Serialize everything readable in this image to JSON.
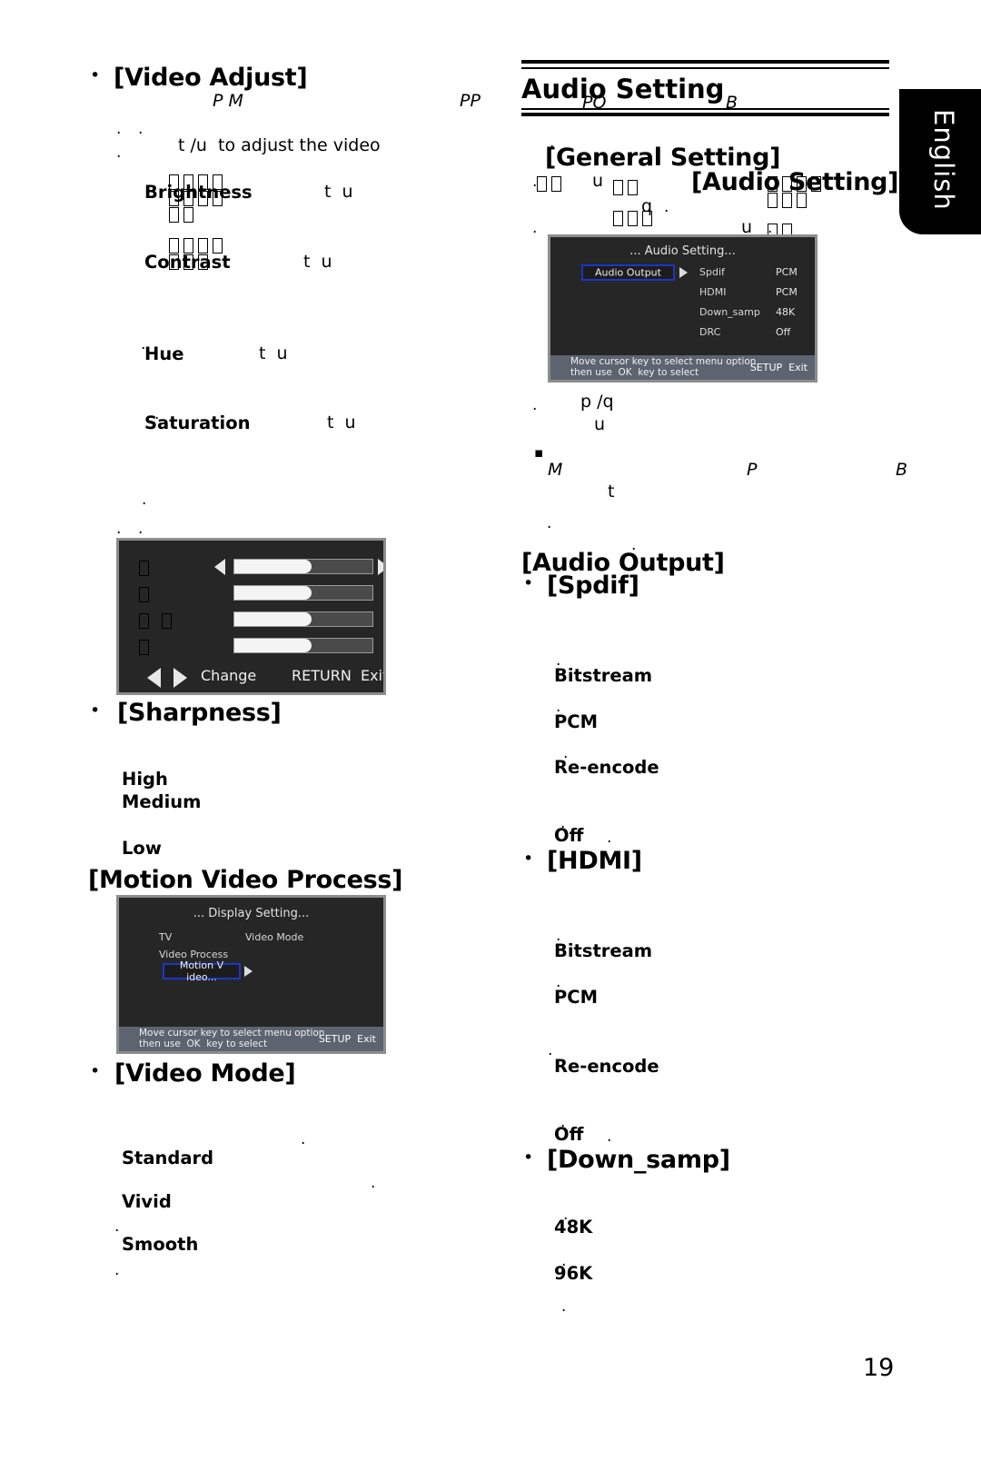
{
  "page": {
    "number": "19",
    "language_tab": "English"
  },
  "left_column": {
    "video_adjust_heading": "[Video Adjust]",
    "frag_pm": "P M",
    "frag_pp": "PP",
    "frag_dot_a": ".",
    "frag_dot_b": ".",
    "frag_dot_c": ".",
    "instruction": "t /u  to adjust the video",
    "items": [
      {
        "label": "Brightness",
        "keys": "t  u"
      },
      {
        "label": "Contrast",
        "keys": "t  u"
      },
      {
        "label": "Hue",
        "keys": "t  u"
      },
      {
        "label": "Saturation",
        "keys": "t  u"
      }
    ],
    "sharpness_heading": "[Sharpness]",
    "sharpness_options": [
      "High",
      "Medium",
      "Low"
    ],
    "motion_video_heading": "[Motion Video Process]",
    "video_mode_heading": "[Video Mode]",
    "video_mode_options": [
      "Standard",
      "Vivid",
      "Smooth"
    ]
  },
  "right_column": {
    "heading": "Audio Setting",
    "heading_frag_po": "PO",
    "heading_frag_b": "B",
    "general_setting": "[General Setting]",
    "audio_setting": "[Audio Setting]",
    "frag_u1": "u",
    "frag_q": "q",
    "frag_u2": "u",
    "frag_pq": "p /q",
    "frag_u3": "u",
    "frag_m": "M",
    "frag_p": "P",
    "frag_b": "B",
    "frag_t": "t",
    "audio_output_heading": "[Audio Output]",
    "spdif_heading": "[Spdif]",
    "spdif_options": [
      "Bitstream",
      "PCM",
      "Re-encode",
      "Off"
    ],
    "hdmi_heading": "[HDMI]",
    "hdmi_options": [
      "Bitstream",
      "PCM",
      "Re-encode",
      "Off"
    ],
    "down_samp_heading": "[Down_samp]",
    "down_samp_options": [
      "48K",
      "96K"
    ]
  },
  "osd_video_adjust": {
    "rows": [
      {
        "tofu": 1
      },
      {
        "tofu": 1
      },
      {
        "tofu": 2
      },
      {
        "tofu": 1
      }
    ],
    "fill_percent": [
      56,
      56,
      56,
      56
    ],
    "footer_change": "Change",
    "footer_return": "RETURN  Exit"
  },
  "osd_display_setting": {
    "title": "... Display Setting...",
    "col1": [
      "TV",
      "Video Process"
    ],
    "col2": [
      "Video Mode"
    ],
    "selected": "Motion V ideo...",
    "footer_line1": "Move cursor key to select menu option",
    "footer_line2": "then use  OK  key to select",
    "footer_right": "SETUP  Exit"
  },
  "osd_audio_setting": {
    "title": "... Audio Setting...",
    "selected": "Audio Output",
    "rows": [
      {
        "name": "Spdif",
        "value": "PCM"
      },
      {
        "name": "HDMI",
        "value": "PCM"
      },
      {
        "name": "Down_samp",
        "value": "48K"
      },
      {
        "name": "DRC",
        "value": "Off"
      }
    ],
    "footer_line1": "Move cursor key to select menu option",
    "footer_line2": "then use  OK  key to select",
    "footer_right": "SETUP  Exit"
  },
  "colors": {
    "osd_bg": "#262626",
    "osd_border": "#8d8d8d",
    "osd_footer": "#5c6470",
    "selection_outline": "#1b36c8",
    "slider_fill": "#f4f4f4",
    "slider_track": "#4a4a4a"
  }
}
